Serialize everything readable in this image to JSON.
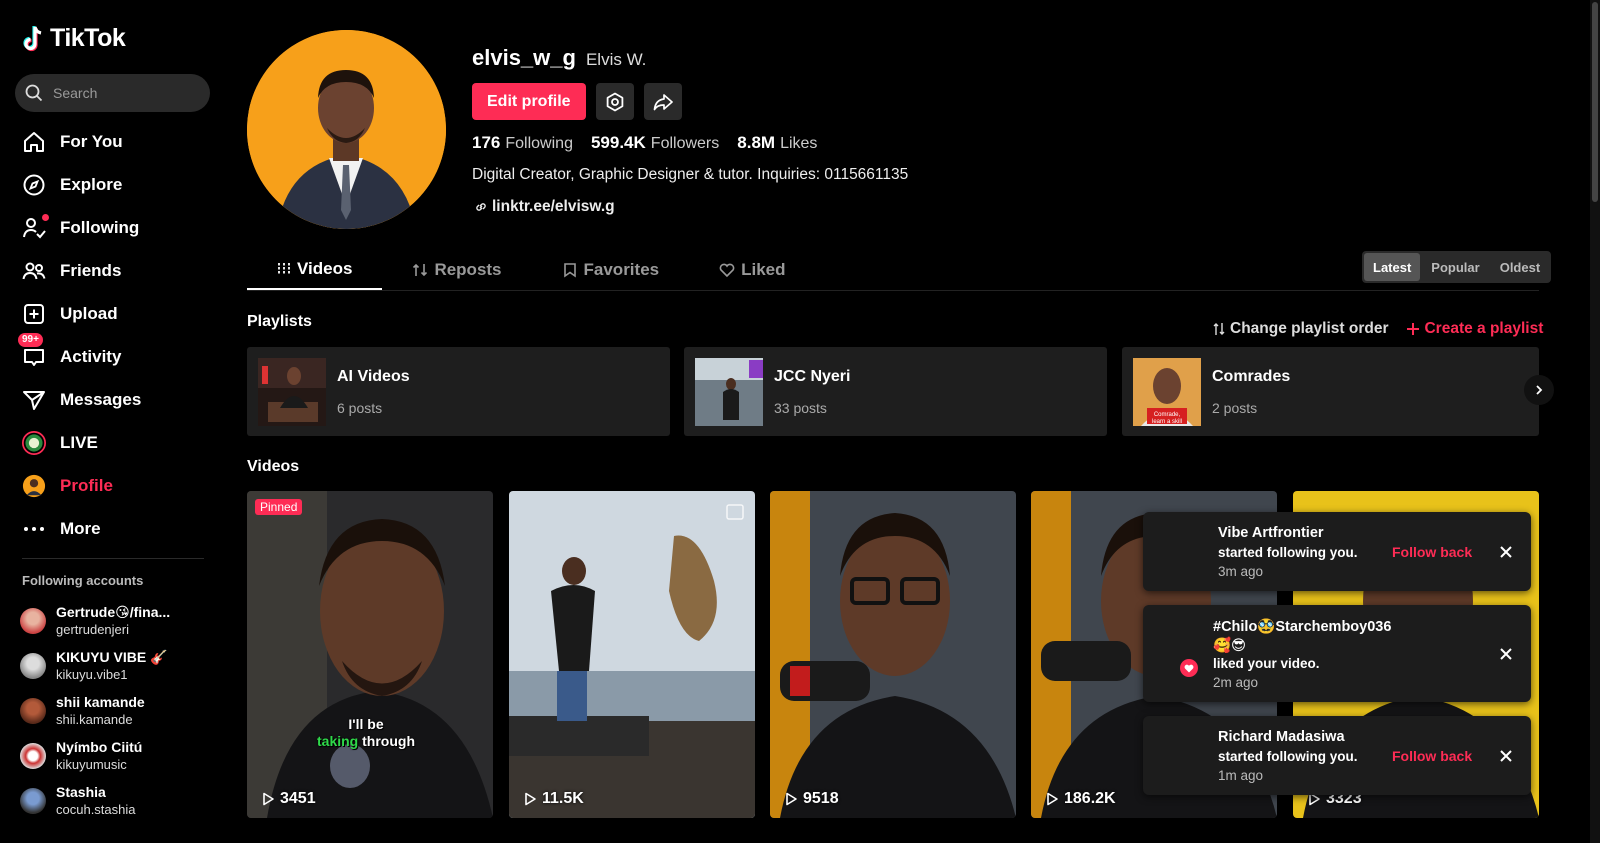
{
  "app": {
    "logo_text": "TikTok",
    "accent": "#fe2c55"
  },
  "search": {
    "placeholder": "Search"
  },
  "nav": [
    {
      "label": "For You",
      "icon": "home-icon"
    },
    {
      "label": "Explore",
      "icon": "compass-icon"
    },
    {
      "label": "Following",
      "icon": "following-icon"
    },
    {
      "label": "Friends",
      "icon": "friends-icon"
    },
    {
      "label": "Upload",
      "icon": "upload-icon"
    },
    {
      "label": "Activity",
      "icon": "inbox-icon",
      "badge": "99+"
    },
    {
      "label": "Messages",
      "icon": "send-icon"
    },
    {
      "label": "LIVE",
      "icon": "live-icon"
    },
    {
      "label": "Profile",
      "icon": "profile-avatar",
      "active": true
    },
    {
      "label": "More",
      "icon": "more-icon"
    }
  ],
  "following_accounts": {
    "title": "Following accounts",
    "items": [
      {
        "name": "Gertrude😘/fina...",
        "handle": "gertrudenjeri"
      },
      {
        "name": "KIKUYU VIBE 🎸",
        "handle": "kikuyu.vibe1"
      },
      {
        "name": "shii kamande",
        "handle": "shii.kamande"
      },
      {
        "name": "Nyímbo Ciitú",
        "handle": "kikuyumusic"
      },
      {
        "name": "Stashia",
        "handle": "cocuh.stashia"
      }
    ]
  },
  "profile": {
    "username": "elvis_w_g",
    "display_name": "Elvis W.",
    "edit_label": "Edit profile",
    "stats": {
      "following_count": "176",
      "following_label": "Following",
      "followers_count": "599.4K",
      "followers_label": "Followers",
      "likes_count": "8.8M",
      "likes_label": "Likes"
    },
    "bio": "Digital Creator, Graphic Designer & tutor. Inquiries: 0115661135",
    "link": "linktr.ee/elvisw.g"
  },
  "tabs": [
    "Videos",
    "Reposts",
    "Favorites",
    "Liked"
  ],
  "sort_options": [
    "Latest",
    "Popular",
    "Oldest"
  ],
  "playlists": {
    "title": "Playlists",
    "change_order": "Change playlist order",
    "create": "Create a playlist",
    "items": [
      {
        "name": "AI Videos",
        "count": "6 posts"
      },
      {
        "name": "JCC Nyeri",
        "count": "33 posts"
      },
      {
        "name": "Comrades",
        "count": "2 posts"
      }
    ]
  },
  "videos": {
    "title": "Videos",
    "pinned_label": "Pinned",
    "caption_line1": "I'll be",
    "caption_green": "taking",
    "caption_rest": " through",
    "items": [
      {
        "views": "3451"
      },
      {
        "views": "11.5K"
      },
      {
        "views": "9518"
      },
      {
        "views": "186.2K"
      },
      {
        "views": "3323"
      }
    ]
  },
  "notifications": [
    {
      "user": "Vibe Artfrontier",
      "text": "started following you.",
      "time": "3m ago",
      "action": "Follow back"
    },
    {
      "user": "#Chilo🥸Starchemboy036",
      "user_line2": "🥰😎",
      "text": "liked your video.",
      "time": "2m ago"
    },
    {
      "user": "Richard Madasiwa",
      "text": "started following you.",
      "time": "1m ago",
      "action": "Follow back"
    }
  ]
}
